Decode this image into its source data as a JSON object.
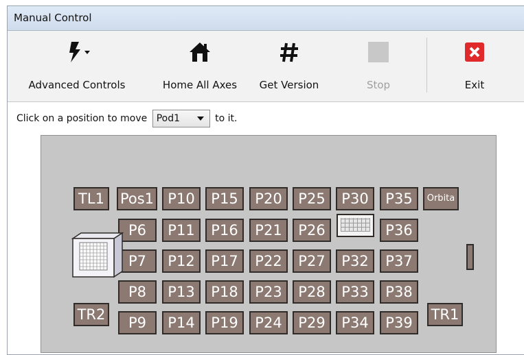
{
  "window": {
    "title": "Manual Control"
  },
  "toolbar": {
    "advanced_controls": "Advanced Controls",
    "home_all_axes": "Home All Axes",
    "get_version": "Get Version",
    "stop": "Stop",
    "exit": "Exit"
  },
  "hint": {
    "prefix": "Click on a position to move",
    "selected_pod": "Pod1",
    "suffix": "to it."
  },
  "deck": {
    "tl1": "TL1",
    "tr1": "TR1",
    "tr2": "TR2",
    "orbital": "Orbita",
    "positions": [
      "Pos1",
      "P10",
      "P15",
      "P20",
      "P25",
      "P30",
      "P35",
      "P6",
      "P11",
      "P16",
      "P21",
      "P26",
      "P36",
      "P7",
      "P12",
      "P17",
      "P22",
      "P27",
      "P32",
      "P37",
      "P8",
      "P13",
      "P18",
      "P23",
      "P28",
      "P33",
      "P38",
      "P9",
      "P14",
      "P19",
      "P24",
      "P29",
      "P34",
      "P39"
    ]
  },
  "colors": {
    "position_fill": "#8c7972",
    "deck_bg": "#c6c6c6",
    "exit_red": "#e0292b"
  },
  "icons": {
    "advanced_controls": "lightning-dropdown-icon",
    "home_all_axes": "house-icon",
    "get_version": "hash-icon",
    "stop": "stop-square-icon",
    "exit": "close-x-icon"
  }
}
